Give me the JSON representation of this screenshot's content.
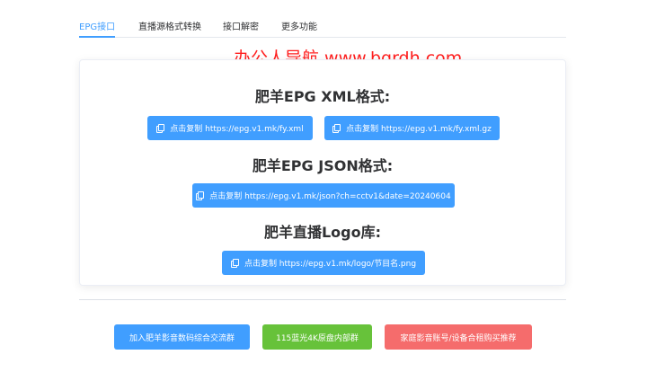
{
  "tabs": [
    {
      "label": "EPG接口",
      "active": true
    },
    {
      "label": "直播源格式转换",
      "active": false
    },
    {
      "label": "接口解密",
      "active": false
    },
    {
      "label": "更多功能",
      "active": false
    }
  ],
  "watermark": "办公人导航  www.bgrdh.com",
  "sections": {
    "xml": {
      "heading": "肥羊EPG XML格式:",
      "buttons": [
        "点击复制 https://epg.v1.mk/fy.xml",
        "点击复制 https://epg.v1.mk/fy.xml.gz"
      ]
    },
    "json": {
      "heading": "肥羊EPG JSON格式:",
      "buttons": [
        "点击复制 https://epg.v1.mk/json?ch=cctv1&date=20240604"
      ]
    },
    "logo": {
      "heading": "肥羊直播Logo库:",
      "buttons": [
        "点击复制 https://epg.v1.mk/logo/节目名.png"
      ]
    }
  },
  "bottom_buttons": [
    {
      "label": "加入肥羊影音数码综合交流群",
      "color": "#409eff"
    },
    {
      "label": "115蓝光4K原盘内部群",
      "color": "#67c23a"
    },
    {
      "label": "家庭影音账号/设备合租购买推荐",
      "color": "#f56c6c"
    }
  ],
  "colors": {
    "primary": "#409eff",
    "success": "#67c23a",
    "danger": "#f56c6c",
    "watermark": "#ff1e1e"
  },
  "icons": {
    "copy": "copy-icon"
  }
}
